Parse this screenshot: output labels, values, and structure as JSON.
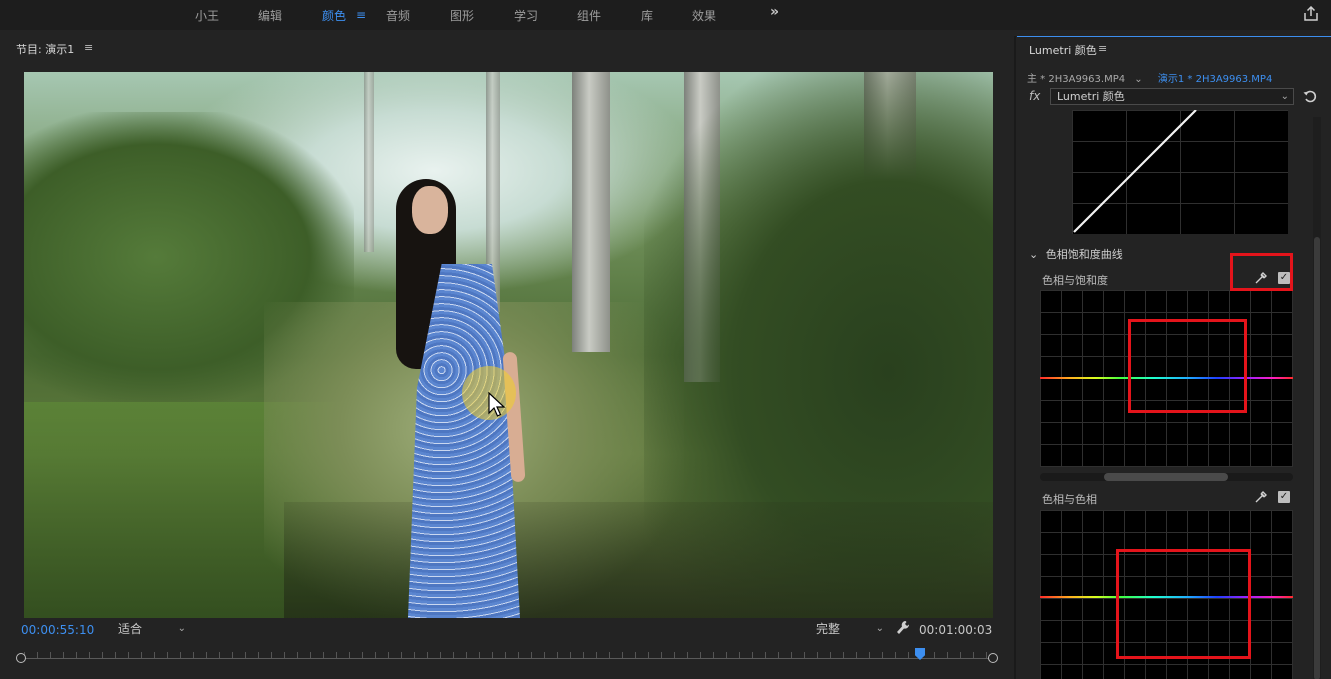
{
  "workspace_tabs": [
    {
      "label": "小王"
    },
    {
      "label": "编辑"
    },
    {
      "label": "颜色"
    },
    {
      "label": "音频"
    },
    {
      "label": "图形"
    },
    {
      "label": "学习"
    },
    {
      "label": "组件"
    },
    {
      "label": "库"
    },
    {
      "label": "效果"
    }
  ],
  "active_tab": "颜色",
  "more_label": "»",
  "monitor": {
    "title": "节目: 演示1",
    "menu_glyph": "≡",
    "timecode_current": "00:00:55:10",
    "fit_value": "适合",
    "quality_value": "完整",
    "timecode_duration": "00:01:00:03"
  },
  "lumetri": {
    "title": "Lumetri 颜色",
    "menu_glyph": "≡",
    "master_clip": "主 * 2H3A9963.MP4",
    "sequence_clip": "演示1 * 2H3A9963.MP4",
    "fx_label": "fx",
    "effect_select": "Lumetri 颜色",
    "section_title": "色相饱和度曲线",
    "hue_vs_sat_label": "色相与饱和度",
    "hue_vs_hue_label": "色相与色相",
    "check_glyph": "✓"
  },
  "colors": {
    "accent": "#3d8ff0",
    "highlight_box": "#e4141b",
    "click_indicator": "#f0d028"
  }
}
